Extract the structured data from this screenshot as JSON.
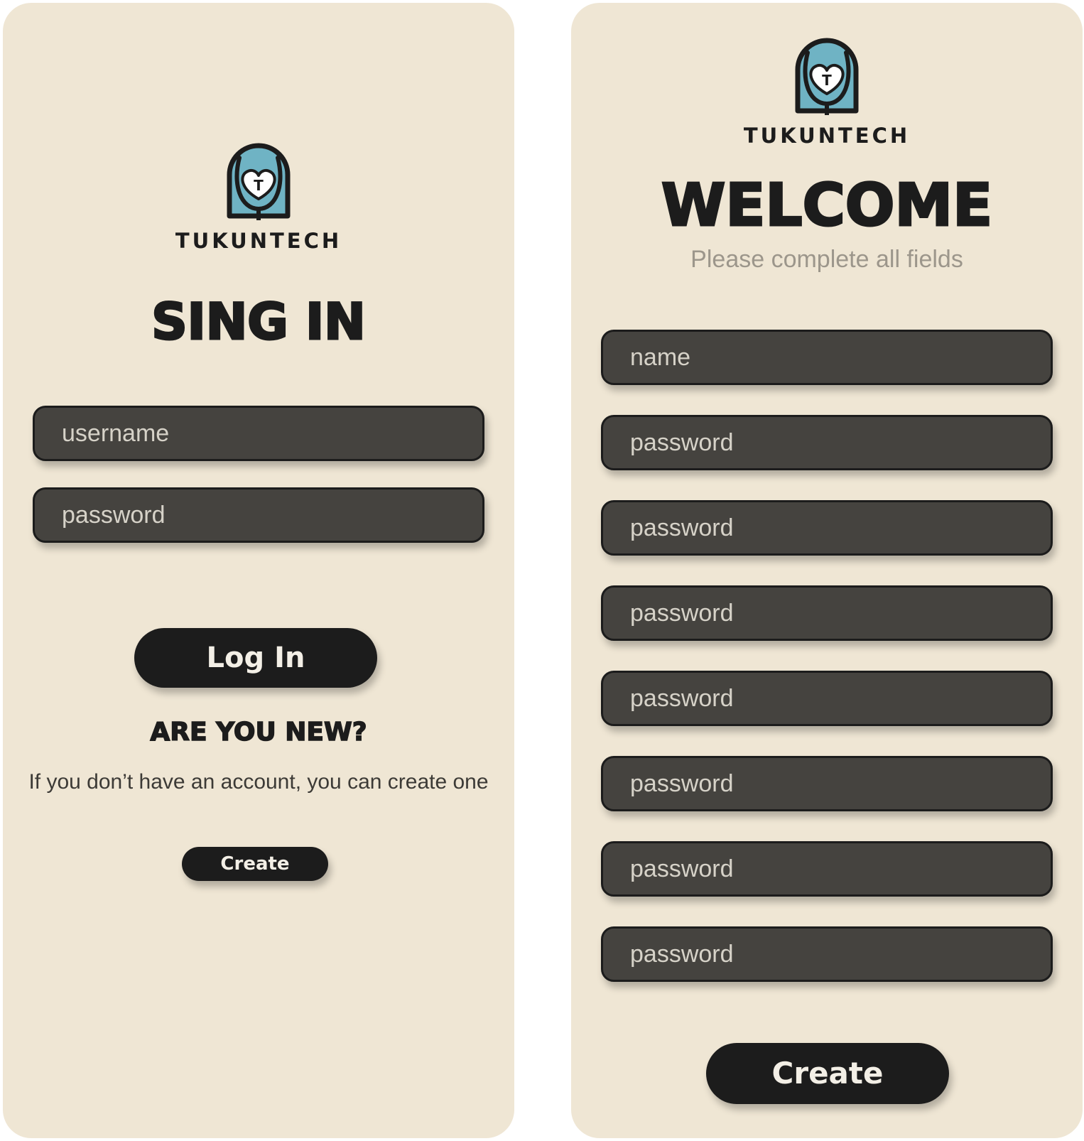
{
  "colors": {
    "card_background": "#efe6d4",
    "field_background": "#45433f",
    "button_background": "#1c1c1c",
    "logo_accent": "#6fb3c4",
    "text_dark": "#1c1c1c",
    "subtitle_gray": "#9c968b"
  },
  "signin": {
    "brand_name": "TUKUNTECH",
    "logo_letter": "T",
    "title": "Sing In",
    "username_placeholder": "username",
    "password_placeholder": "password",
    "login_button": "Log In",
    "new_heading": "ARE YOU NEW?",
    "new_text": "If you don’t have an account, you can create one",
    "create_button": "Create"
  },
  "signup": {
    "brand_name": "TUKUNTECH",
    "logo_letter": "T",
    "title": "WELCOME",
    "subtitle": "Please complete all fields",
    "fields": [
      "name",
      "password",
      "password",
      "password",
      "password",
      "password",
      "password",
      "password"
    ],
    "create_button": "Create"
  }
}
